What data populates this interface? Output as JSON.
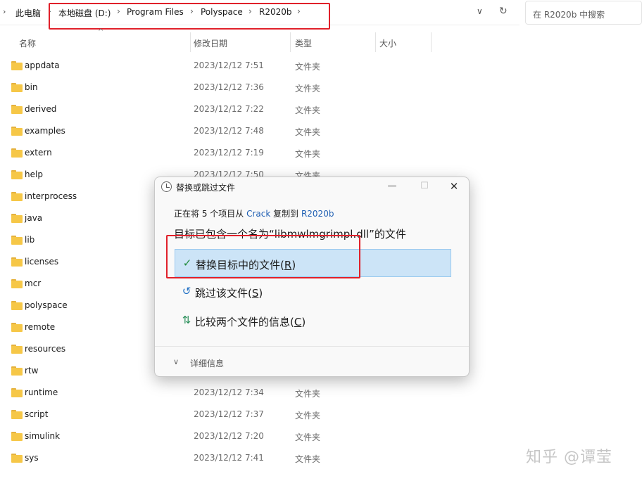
{
  "address_bar": {
    "crumbs": [
      "此电脑",
      "本地磁盘 (D:)",
      "Program Files",
      "Polyspace",
      "R2020b"
    ],
    "search_placeholder": "在 R2020b 中搜索"
  },
  "columns": [
    "名称",
    "修改日期",
    "类型",
    "大小"
  ],
  "files": [
    {
      "name": "appdata",
      "date": "2023/12/12 7:51",
      "type": "文件夹"
    },
    {
      "name": "bin",
      "date": "2023/12/12 7:36",
      "type": "文件夹"
    },
    {
      "name": "derived",
      "date": "2023/12/12 7:22",
      "type": "文件夹"
    },
    {
      "name": "examples",
      "date": "2023/12/12 7:48",
      "type": "文件夹"
    },
    {
      "name": "extern",
      "date": "2023/12/12 7:19",
      "type": "文件夹"
    },
    {
      "name": "help",
      "date": "2023/12/12 7:50",
      "type": "文件夹"
    },
    {
      "name": "interprocess",
      "date": "",
      "type": ""
    },
    {
      "name": "java",
      "date": "",
      "type": ""
    },
    {
      "name": "lib",
      "date": "",
      "type": ""
    },
    {
      "name": "licenses",
      "date": "",
      "type": ""
    },
    {
      "name": "mcr",
      "date": "",
      "type": ""
    },
    {
      "name": "polyspace",
      "date": "",
      "type": ""
    },
    {
      "name": "remote",
      "date": "",
      "type": ""
    },
    {
      "name": "resources",
      "date": "",
      "type": ""
    },
    {
      "name": "rtw",
      "date": "",
      "type": ""
    },
    {
      "name": "runtime",
      "date": "2023/12/12 7:34",
      "type": "文件夹"
    },
    {
      "name": "script",
      "date": "2023/12/12 7:37",
      "type": "文件夹"
    },
    {
      "name": "simulink",
      "date": "2023/12/12 7:20",
      "type": "文件夹"
    },
    {
      "name": "sys",
      "date": "2023/12/12 7:41",
      "type": "文件夹"
    }
  ],
  "dialog": {
    "title": "替换或跳过文件",
    "info_prefix": "正在将 5 个项目从 ",
    "info_source": "Crack",
    "info_middle": " 复制到 ",
    "info_dest": "R2020b",
    "message": "目标已包含一个名为“libmwlmgrimpl.dll”的文件",
    "options": [
      {
        "label": "替换目标中的文件",
        "key": "R",
        "icon": "checkmark-icon"
      },
      {
        "label": "跳过该文件",
        "key": "S",
        "icon": "skip-arrow-icon"
      },
      {
        "label": "比较两个文件的信息",
        "key": "C",
        "icon": "compare-icon"
      }
    ],
    "details_label": "详细信息"
  },
  "watermark": "知乎 @谭莹",
  "colors": {
    "highlight_red": "#e0202a",
    "selected_option_bg": "#cce4f7",
    "link_blue": "#1f5fb3",
    "folder_yellow": "#f6c747"
  }
}
